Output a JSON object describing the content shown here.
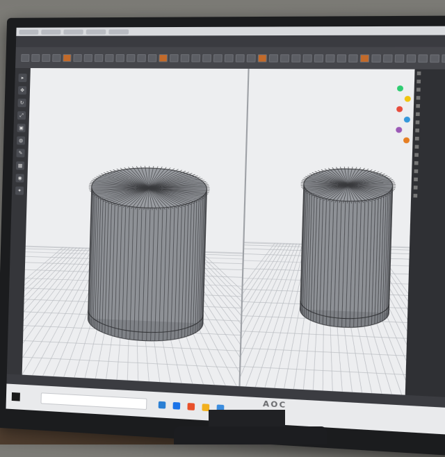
{
  "window": {
    "tabs": [
      "",
      "",
      "",
      "",
      ""
    ]
  },
  "menu": {
    "items": [
      "",
      "",
      "",
      "",
      "",
      "",
      "",
      "",
      "",
      ""
    ]
  },
  "toolbar": {
    "tool_count": 40
  },
  "viewport": {
    "label": "",
    "objects": [
      {
        "name": "cylinder-left"
      },
      {
        "name": "cylinder-right"
      }
    ]
  },
  "right_panel": {
    "rows": [
      "",
      "",
      "",
      "",
      "",
      "",
      "",
      "",
      "",
      "",
      "",
      "",
      "",
      "",
      "",
      ""
    ],
    "color_dots": [
      "#2ecc71",
      "#f1c40f",
      "#e74c3c",
      "#3498db",
      "#9b59b6",
      "#e67e22"
    ]
  },
  "taskbar": {
    "search_placeholder": "",
    "app_icons": [
      {
        "name": "edge-icon",
        "color": "#2a7fd4"
      },
      {
        "name": "store-icon",
        "color": "#1a73e8"
      },
      {
        "name": "office-icon",
        "color": "#e8502a"
      },
      {
        "name": "explorer-icon",
        "color": "#f2b01e"
      },
      {
        "name": "app-icon",
        "color": "#3c8dde"
      }
    ]
  },
  "colors": {
    "ui_dark": "#2b2c30",
    "viewport_bg": "#edeef0",
    "mesh": "#6d6f73",
    "accent": "#c26a2a"
  }
}
